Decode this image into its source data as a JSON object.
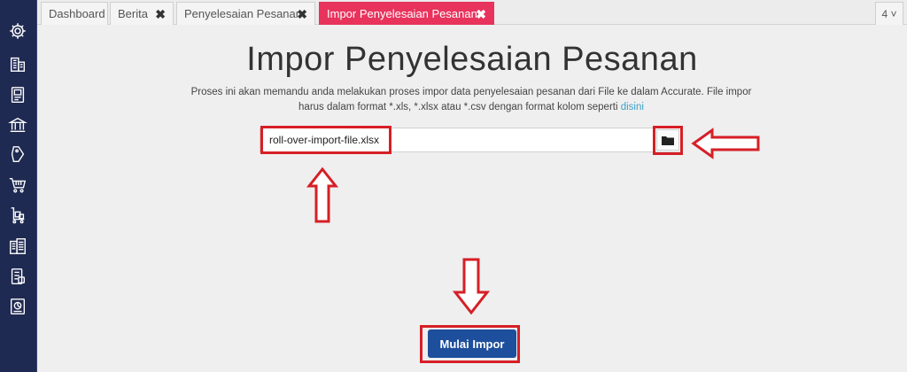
{
  "tabs": [
    {
      "label": "Dashboard",
      "closable": false
    },
    {
      "label": "Berita",
      "closable": true
    },
    {
      "label": "Penyelesaian Pesanan",
      "closable": true
    },
    {
      "label": "Impor Penyelesaian Pesanan",
      "closable": true,
      "active": true
    }
  ],
  "tab_count": "4 ˅",
  "close_glyph": "✖",
  "page": {
    "title": "Impor Penyelesaian Pesanan",
    "description": "Proses ini akan memandu anda melakukan proses impor data penyelesaian pesanan dari File ke dalam Accurate. File impor harus dalam format *.xls, *.xlsx atau *.csv dengan format kolom seperti",
    "link_text": "disini"
  },
  "file": {
    "value": "roll-over-import-file.xlsx"
  },
  "start_button_label": "Mulai Impor",
  "sidebar_icons": [
    "settings-icon",
    "company-icon",
    "ledger-icon",
    "bank-icon",
    "price-tag-icon",
    "cart-icon",
    "inventory-icon",
    "building-list-icon",
    "tax-icon",
    "report-icon"
  ],
  "colors": {
    "sidebar": "#1f2a52",
    "active_tab": "#e8335d",
    "primary_button": "#1d4f9c",
    "annotation": "#d61f26"
  }
}
